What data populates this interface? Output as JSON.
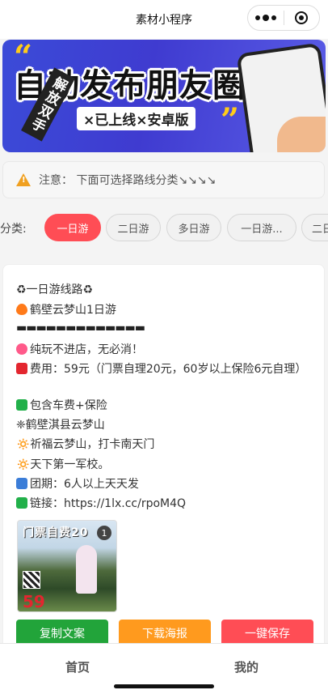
{
  "nav": {
    "title": "素材小程序",
    "more_icon": "more-dots-icon",
    "close_icon": "target-icon"
  },
  "banner": {
    "title": "自动发布朋友圈",
    "subtitle": "×已上线×安卓版",
    "phone_text": "解放双手",
    "colors": {
      "bg": "#3f3bd0",
      "accent": "#ffcc1a"
    }
  },
  "notice": {
    "icon": "warning-icon",
    "text": "注意： 下面可选择路线分类↘↘↘↘"
  },
  "categories": {
    "label": "分类:",
    "items": [
      "一日游",
      "二日游",
      "多日游",
      "一日游...",
      "二日"
    ],
    "active_index": 0,
    "active_color": "#ff4d55"
  },
  "post": {
    "lines": [
      "♻一日游线路♻",
      "鹤壁云梦山1日游",
      "▬▬▬▬▬▬▬▬▬▬▬▬▬",
      "纯玩不进店，无必消！",
      "费用：59元（门票自理20元，60岁以上保险6元自理）",
      "包含车费+保险",
      "❈鹤壁淇县云梦山",
      "🔅祈福云梦山，打卡南天门",
      "🔅天下第一军校。",
      "团期：6人以上天天发",
      "链接：https://1lx.cc/rpoM4Q"
    ],
    "thumb": {
      "title": "门票自费20",
      "badge": "1",
      "price": "59"
    },
    "buttons": [
      {
        "label": "复制文案",
        "color": "#22a43a"
      },
      {
        "label": "下载海报",
        "color": "#ff9a1e"
      },
      {
        "label": "一键保存",
        "color": "#ff4d55"
      }
    ]
  },
  "tabbar": {
    "items": [
      "首页",
      "我的"
    ]
  }
}
